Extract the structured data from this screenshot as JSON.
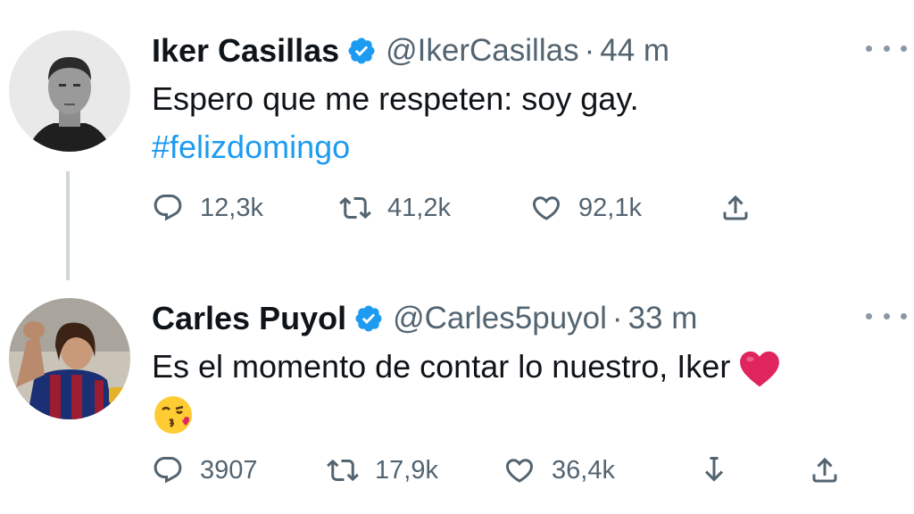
{
  "tweets": [
    {
      "name": "Iker Casillas",
      "handle": "@IkerCasillas",
      "separator": "·",
      "time": "44 m",
      "text": "Espero que me respeten: soy gay.",
      "hashtag": "#felizdomingo",
      "replies": "12,3k",
      "retweets": "41,2k",
      "likes": "92,1k"
    },
    {
      "name": "Carles Puyol",
      "handle": "@Carles5puyol",
      "separator": "·",
      "time": "33 m",
      "text": "Es el momento de contar lo nuestro, Iker",
      "replies": "3907",
      "retweets": "17,9k",
      "likes": "36,4k"
    }
  ],
  "colors": {
    "hashtag": "#1d9bf0",
    "verified": "#1d9bf0",
    "muted": "#536471",
    "heart_emoji": "#e0245e"
  },
  "icons": [
    "verified-badge-icon",
    "more-options-icon",
    "reply-icon",
    "retweet-icon",
    "like-icon",
    "download-icon",
    "share-icon",
    "red-heart-emoji",
    "kissing-face-emoji"
  ]
}
